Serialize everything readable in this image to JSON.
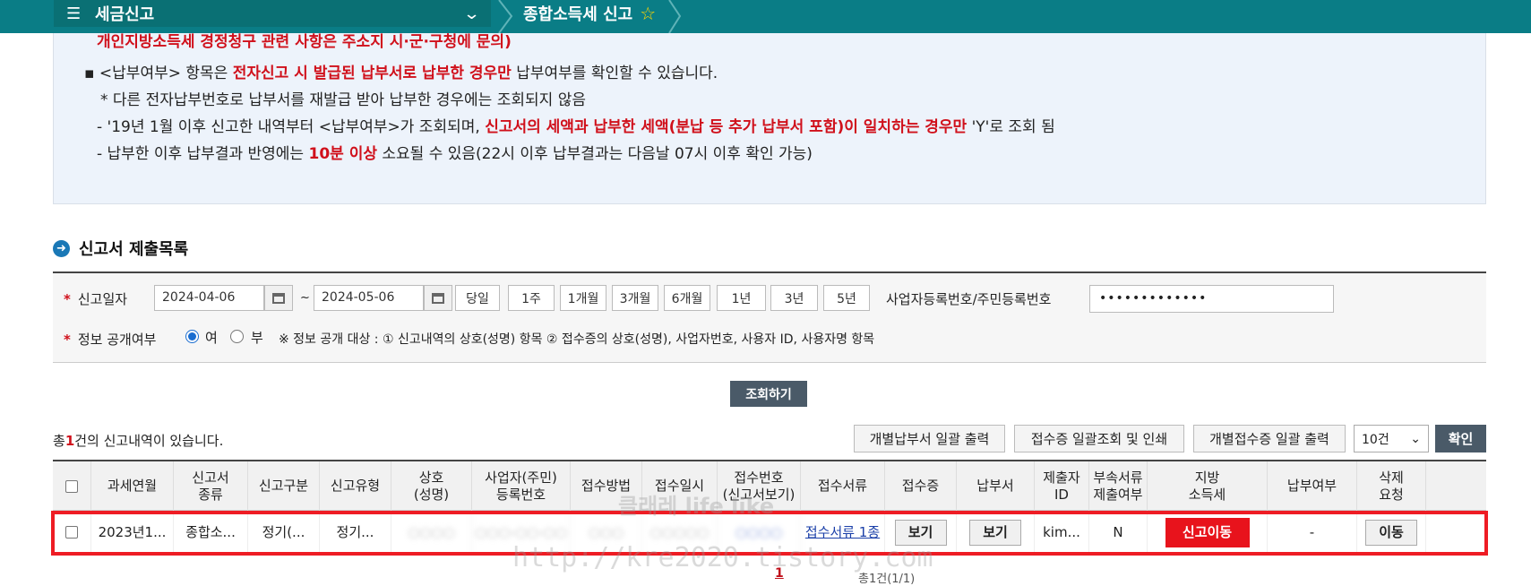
{
  "topbar": {
    "menu_label": "세금신고",
    "breadcrumb": "종합소득세 신고"
  },
  "notice": {
    "line0": "개인지방소득세 경정청구 관련 사항은 주소지 시·군·구청에 문의)",
    "line1_a": "▪ <납부여부> 항목은 ",
    "line1_b": "전자신고 시 발급된 납부서로 납부한 경우만",
    "line1_c": " 납부여부를 확인할 수 있습니다.",
    "line2": "* 다른 전자납부번호로 납부서를 재발급 받아 납부한 경우에는 조회되지 않음",
    "line3_a": "- '19년 1월 이후 신고한 내역부터 <납부여부>가 조회되며, ",
    "line3_b": "신고서의 세액과 납부한 세액(분납 등 추가 납부서 포함)이 일치하는 경우만",
    "line3_c": " 'Y'로 조회 됨",
    "line4_a": "- 납부한 이후 납부결과 반영에는 ",
    "line4_b": "10분 이상",
    "line4_c": " 소요될 수 있음(22시 이후 납부결과는 다음날 07시 이후 확인 가능)"
  },
  "section_title": "신고서 제출목록",
  "search": {
    "req_mark": "*",
    "date_label": "신고일자",
    "date_from": "2024-04-06",
    "date_to": "2024-05-06",
    "tilde": "~",
    "periods": [
      "당일",
      "1주",
      "1개월",
      "3개월",
      "6개월",
      "1년",
      "3년",
      "5년"
    ],
    "id_label": "사업자등록번호/주민등록번호",
    "id_value": "•••••••••••••",
    "disclose_label": "정보 공개여부",
    "opt_yes": "여",
    "opt_no": "부",
    "disclose_note": "※ 정보 공개 대상 : ① 신고내역의 상호(성명) 항목 ② 접수증의 상호(성명), 사업자번호, 사용자 ID, 사용자명 항목"
  },
  "query_button": "조회하기",
  "count": {
    "prefix": "총",
    "num": "1",
    "suffix": "건의 신고내역이 있습니다."
  },
  "actions": {
    "btn1": "개별납부서 일괄 출력",
    "btn2": "접수증 일괄조회 및 인쇄",
    "btn3": "개별접수증 일괄 출력",
    "page_size": "10건",
    "ok": "확인"
  },
  "table": {
    "headers": {
      "year": "과세연월",
      "kind1": "신고서",
      "kind2": "종류",
      "type": "신고구분",
      "form": "신고유형",
      "name1": "상호",
      "name2": "(성명)",
      "biz1": "사업자(주민)",
      "biz2": "등록번호",
      "method": "접수방법",
      "date": "접수일시",
      "rcpt1": "접수번호",
      "rcpt2": "(신고서보기)",
      "docs": "접수서류",
      "receipt": "접수증",
      "bill": "납부서",
      "sub1": "제출자",
      "sub2": "ID",
      "att1": "부속서류",
      "att2": "제출여부",
      "local1": "지방",
      "local2": "소득세",
      "paid": "납부여부",
      "del1": "삭제",
      "del2": "요청"
    },
    "row": {
      "year": "2023년1...",
      "kind": "종합소...",
      "type": "정기(...",
      "form": "정기...",
      "name": "○○○○",
      "biz": "○○○-○○-○○",
      "method": "○○○",
      "date": "○○○○○",
      "rcpt": "○○○○",
      "docs": "접수서류 1종",
      "receipt": "보기",
      "bill": "보기",
      "submitter": "kim...",
      "attached": "N",
      "local": "신고이동",
      "paid": "-",
      "del": "이동"
    }
  },
  "pager": {
    "page": "1",
    "total": "총1건(1/1)"
  },
  "watermark": {
    "line1": "클래레 life like",
    "line2": "http://kre2020.tistory.com"
  }
}
